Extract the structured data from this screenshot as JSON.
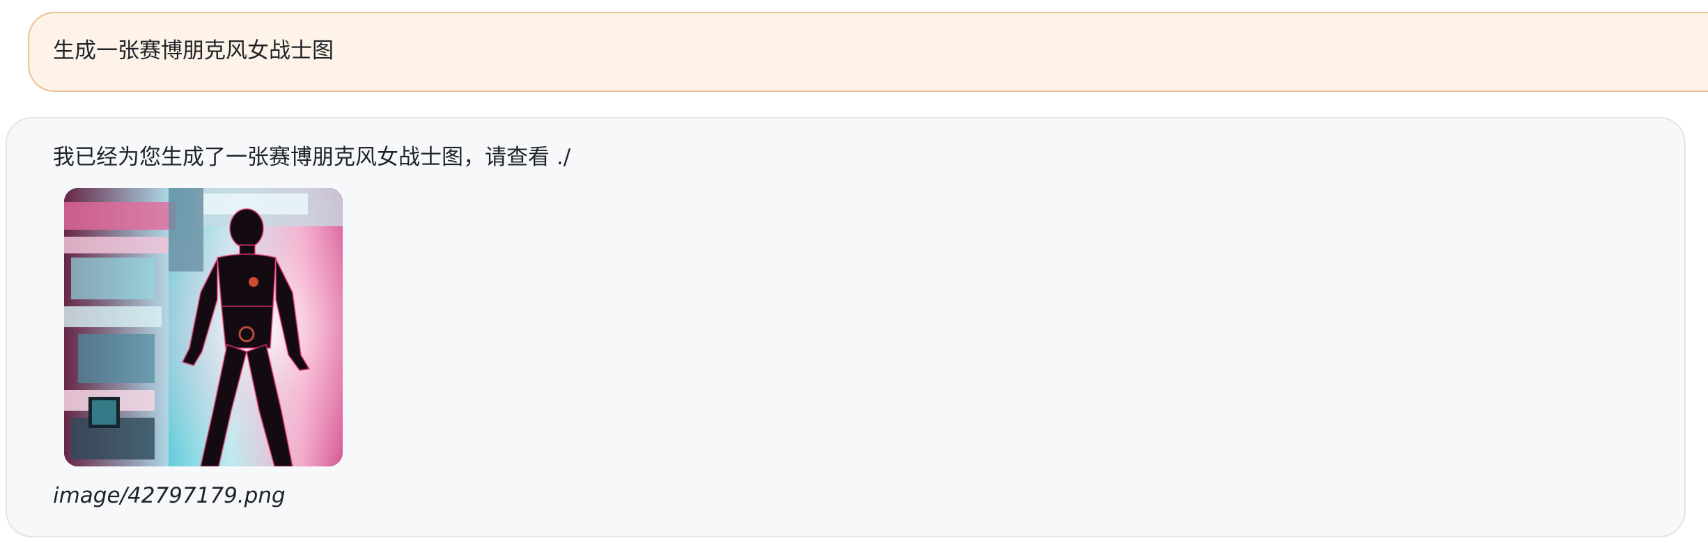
{
  "conversation": {
    "user_message": {
      "text": "生成一张赛博朋克风女战士图"
    },
    "assistant_message": {
      "text": "我已经为您生成了一张赛博朋克风女战士图，请查看 ./",
      "image": {
        "description": "cyberpunk female warrior robot figure in front of neon machinery, pink and cyan lighting",
        "icon": "generated-image"
      },
      "caption": "image/42797179.png"
    }
  },
  "colors": {
    "user_bubble_bg": "#fdf3e8",
    "user_bubble_border": "#e7c38f",
    "assistant_bubble_bg": "#f7f8fa",
    "assistant_bubble_border": "#e3e5e9",
    "text": "#1f2328"
  }
}
